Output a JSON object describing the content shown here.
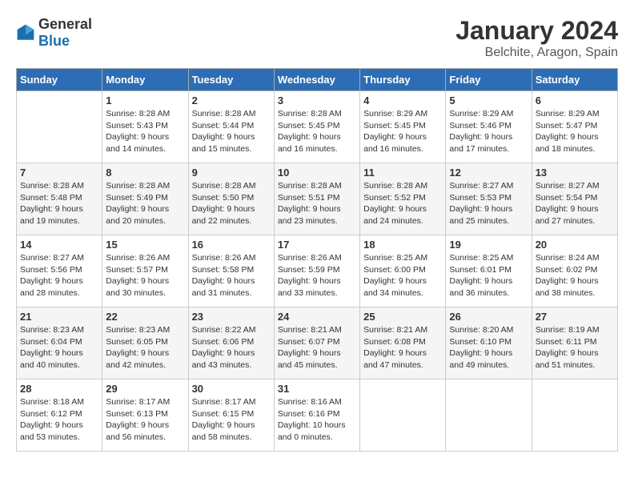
{
  "logo": {
    "general": "General",
    "blue": "Blue"
  },
  "title": {
    "month": "January 2024",
    "location": "Belchite, Aragon, Spain"
  },
  "headers": [
    "Sunday",
    "Monday",
    "Tuesday",
    "Wednesday",
    "Thursday",
    "Friday",
    "Saturday"
  ],
  "weeks": [
    [
      {
        "day": "",
        "info": ""
      },
      {
        "day": "1",
        "info": "Sunrise: 8:28 AM\nSunset: 5:43 PM\nDaylight: 9 hours\nand 14 minutes."
      },
      {
        "day": "2",
        "info": "Sunrise: 8:28 AM\nSunset: 5:44 PM\nDaylight: 9 hours\nand 15 minutes."
      },
      {
        "day": "3",
        "info": "Sunrise: 8:28 AM\nSunset: 5:45 PM\nDaylight: 9 hours\nand 16 minutes."
      },
      {
        "day": "4",
        "info": "Sunrise: 8:29 AM\nSunset: 5:45 PM\nDaylight: 9 hours\nand 16 minutes."
      },
      {
        "day": "5",
        "info": "Sunrise: 8:29 AM\nSunset: 5:46 PM\nDaylight: 9 hours\nand 17 minutes."
      },
      {
        "day": "6",
        "info": "Sunrise: 8:29 AM\nSunset: 5:47 PM\nDaylight: 9 hours\nand 18 minutes."
      }
    ],
    [
      {
        "day": "7",
        "info": "Sunrise: 8:28 AM\nSunset: 5:48 PM\nDaylight: 9 hours\nand 19 minutes."
      },
      {
        "day": "8",
        "info": "Sunrise: 8:28 AM\nSunset: 5:49 PM\nDaylight: 9 hours\nand 20 minutes."
      },
      {
        "day": "9",
        "info": "Sunrise: 8:28 AM\nSunset: 5:50 PM\nDaylight: 9 hours\nand 22 minutes."
      },
      {
        "day": "10",
        "info": "Sunrise: 8:28 AM\nSunset: 5:51 PM\nDaylight: 9 hours\nand 23 minutes."
      },
      {
        "day": "11",
        "info": "Sunrise: 8:28 AM\nSunset: 5:52 PM\nDaylight: 9 hours\nand 24 minutes."
      },
      {
        "day": "12",
        "info": "Sunrise: 8:27 AM\nSunset: 5:53 PM\nDaylight: 9 hours\nand 25 minutes."
      },
      {
        "day": "13",
        "info": "Sunrise: 8:27 AM\nSunset: 5:54 PM\nDaylight: 9 hours\nand 27 minutes."
      }
    ],
    [
      {
        "day": "14",
        "info": "Sunrise: 8:27 AM\nSunset: 5:56 PM\nDaylight: 9 hours\nand 28 minutes."
      },
      {
        "day": "15",
        "info": "Sunrise: 8:26 AM\nSunset: 5:57 PM\nDaylight: 9 hours\nand 30 minutes."
      },
      {
        "day": "16",
        "info": "Sunrise: 8:26 AM\nSunset: 5:58 PM\nDaylight: 9 hours\nand 31 minutes."
      },
      {
        "day": "17",
        "info": "Sunrise: 8:26 AM\nSunset: 5:59 PM\nDaylight: 9 hours\nand 33 minutes."
      },
      {
        "day": "18",
        "info": "Sunrise: 8:25 AM\nSunset: 6:00 PM\nDaylight: 9 hours\nand 34 minutes."
      },
      {
        "day": "19",
        "info": "Sunrise: 8:25 AM\nSunset: 6:01 PM\nDaylight: 9 hours\nand 36 minutes."
      },
      {
        "day": "20",
        "info": "Sunrise: 8:24 AM\nSunset: 6:02 PM\nDaylight: 9 hours\nand 38 minutes."
      }
    ],
    [
      {
        "day": "21",
        "info": "Sunrise: 8:23 AM\nSunset: 6:04 PM\nDaylight: 9 hours\nand 40 minutes."
      },
      {
        "day": "22",
        "info": "Sunrise: 8:23 AM\nSunset: 6:05 PM\nDaylight: 9 hours\nand 42 minutes."
      },
      {
        "day": "23",
        "info": "Sunrise: 8:22 AM\nSunset: 6:06 PM\nDaylight: 9 hours\nand 43 minutes."
      },
      {
        "day": "24",
        "info": "Sunrise: 8:21 AM\nSunset: 6:07 PM\nDaylight: 9 hours\nand 45 minutes."
      },
      {
        "day": "25",
        "info": "Sunrise: 8:21 AM\nSunset: 6:08 PM\nDaylight: 9 hours\nand 47 minutes."
      },
      {
        "day": "26",
        "info": "Sunrise: 8:20 AM\nSunset: 6:10 PM\nDaylight: 9 hours\nand 49 minutes."
      },
      {
        "day": "27",
        "info": "Sunrise: 8:19 AM\nSunset: 6:11 PM\nDaylight: 9 hours\nand 51 minutes."
      }
    ],
    [
      {
        "day": "28",
        "info": "Sunrise: 8:18 AM\nSunset: 6:12 PM\nDaylight: 9 hours\nand 53 minutes."
      },
      {
        "day": "29",
        "info": "Sunrise: 8:17 AM\nSunset: 6:13 PM\nDaylight: 9 hours\nand 56 minutes."
      },
      {
        "day": "30",
        "info": "Sunrise: 8:17 AM\nSunset: 6:15 PM\nDaylight: 9 hours\nand 58 minutes."
      },
      {
        "day": "31",
        "info": "Sunrise: 8:16 AM\nSunset: 6:16 PM\nDaylight: 10 hours\nand 0 minutes."
      },
      {
        "day": "",
        "info": ""
      },
      {
        "day": "",
        "info": ""
      },
      {
        "day": "",
        "info": ""
      }
    ]
  ]
}
